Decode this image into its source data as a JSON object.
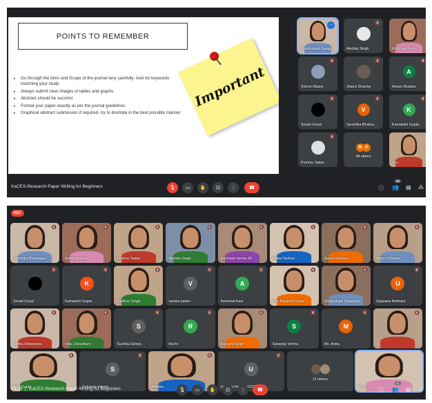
{
  "top": {
    "slide": {
      "title": "POINTS TO REMEMBER",
      "bullets": [
        "Go through the Aims and Scope of the journal very carefully- look for keywords matching your study",
        "Always submit clear images of tables and graphs",
        "Abstract should be succinct",
        "Format your paper exactly as per the journal guidelines",
        "Graphical abstract submission if required- try to illustrate in the best possible manner"
      ],
      "sticky_note": "Important"
    },
    "tiles": [
      {
        "name": "Shubhanjali Dasgu..."
      },
      {
        "name": "Akshita Singh"
      },
      {
        "name": "Ruchiraa Verm..."
      },
      {
        "name": "Simran Basra"
      },
      {
        "name": "Jhanvi Sharma"
      },
      {
        "name": "Aiman Muskan",
        "initial": "A"
      },
      {
        "name": "Sonali Goyal"
      },
      {
        "name": "Vanshika Bhatna...",
        "initial": "V"
      },
      {
        "name": "Kamakshi Gupta",
        "initial": "K"
      },
      {
        "name": "Pummy Yadav"
      },
      {
        "name": "48 others",
        "initials": [
          "M",
          "V"
        ]
      },
      {
        "name": "You"
      }
    ],
    "bar": {
      "meeting_title": "KaCES-Research Paper Writing for Beginners",
      "participants_count": "60"
    }
  },
  "bottom": {
    "rec_label": "REC",
    "tiles": [
      {
        "name": "Vanshika Bhatnagar"
      },
      {
        "name": "Astha Agarwal"
      },
      {
        "name": "Pummy Yadav"
      },
      {
        "name": "Akshita Singh"
      },
      {
        "name": "Ruchiraa Verma 56"
      },
      {
        "name": "Ritika Yachna"
      },
      {
        "name": "Aiman Muskan"
      },
      {
        "name": "Jhanvi Sharma"
      },
      {
        "name": "Sonali Goyal"
      },
      {
        "name": "Kamakshi Gupta",
        "initial": "K"
      },
      {
        "name": "Madhuri Singh"
      },
      {
        "name": "varsha yadav",
        "initial": "V"
      },
      {
        "name": "Ashmeet Kaur",
        "initial": "A"
      },
      {
        "name": "Urvi Manjush Gupte"
      },
      {
        "name": "Shubhanjali Dasgupta"
      },
      {
        "name": "Upasana Nebhani",
        "initial": "U"
      },
      {
        "name": "Kritika Srivastava"
      },
      {
        "name": "Indu Choudhary"
      },
      {
        "name": "Suchita Dahiya",
        "initial": "S"
      },
      {
        "name": "Ruchi",
        "initial": "R"
      },
      {
        "name": "Aayushi Singh"
      },
      {
        "name": "Sukanya Verma",
        "initial": "S"
      },
      {
        "name": "Ms. Anita",
        "initial": "M"
      },
      {
        "name": ""
      },
      {
        "name": "Aditi Gupta"
      },
      {
        "name": "Sukanya Verma",
        "initial": "S"
      },
      {
        "name": "Ambika"
      },
      {
        "name": "Upanshi Agarwal1038",
        "initial": "U"
      },
      {
        "name": "12 others"
      },
      {
        "name": "You"
      }
    ],
    "bar": {
      "time": "19:44",
      "separator": "|",
      "meeting_title": "KaCES-Research Paper Writing for Beginners",
      "participants_count": "61"
    }
  },
  "colors": {
    "accent": "#1a73e8",
    "end_call": "#ea4335",
    "tile_bg": "#3c4043",
    "meet_bg": "#202124"
  }
}
